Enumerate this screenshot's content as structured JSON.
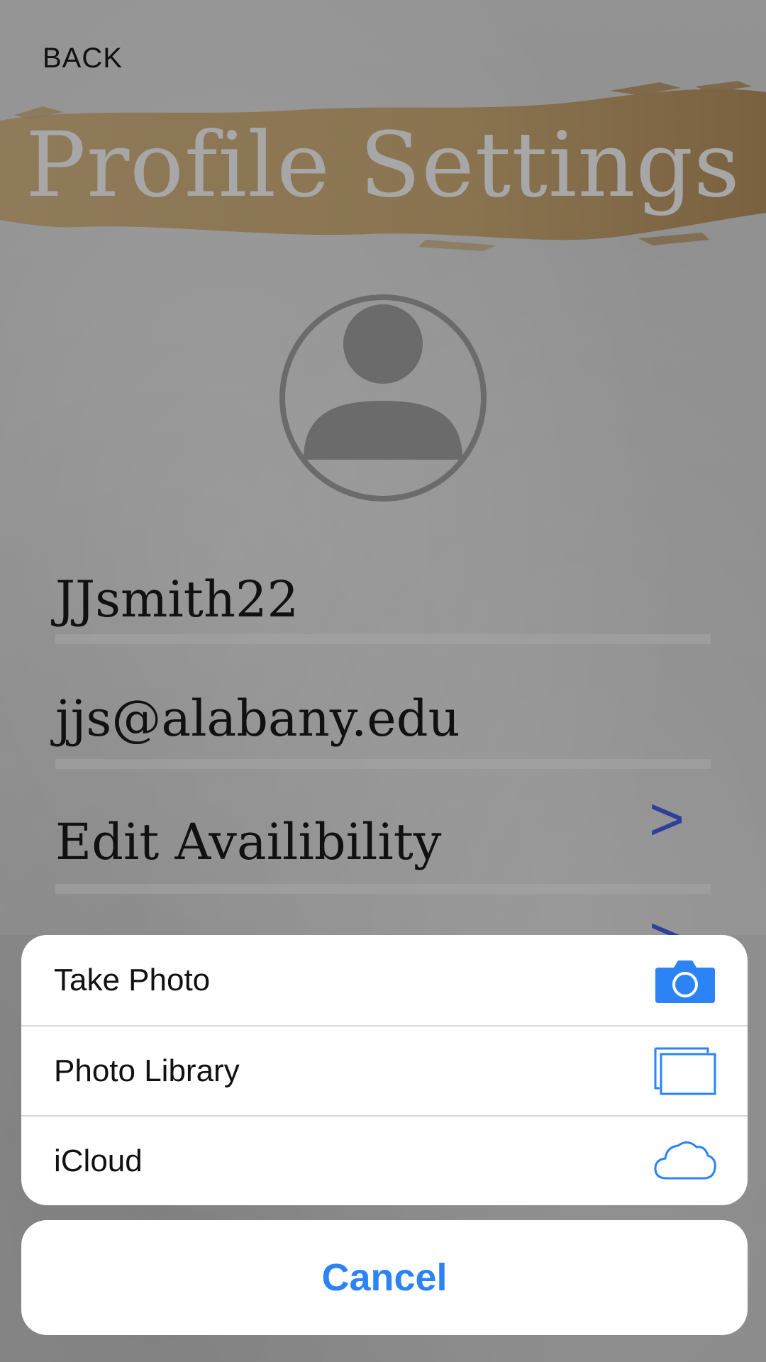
{
  "header": {
    "back_label": "BACK",
    "title": "Profile Settings"
  },
  "profile": {
    "username": "JJsmith22",
    "email": "jjs@alabany.edu",
    "edit_availability_label": "Edit Availibility",
    "chevron_glyph": ">"
  },
  "action_sheet": {
    "items": [
      {
        "label": "Take Photo",
        "icon": "camera-icon"
      },
      {
        "label": "Photo Library",
        "icon": "photo-library-icon"
      },
      {
        "label": "iCloud",
        "icon": "cloud-icon"
      }
    ],
    "cancel_label": "Cancel"
  },
  "colors": {
    "accent_blue": "#2b83f6",
    "chevron_blue": "#2f3f9b",
    "brush_gold": "#9a7a4a"
  }
}
